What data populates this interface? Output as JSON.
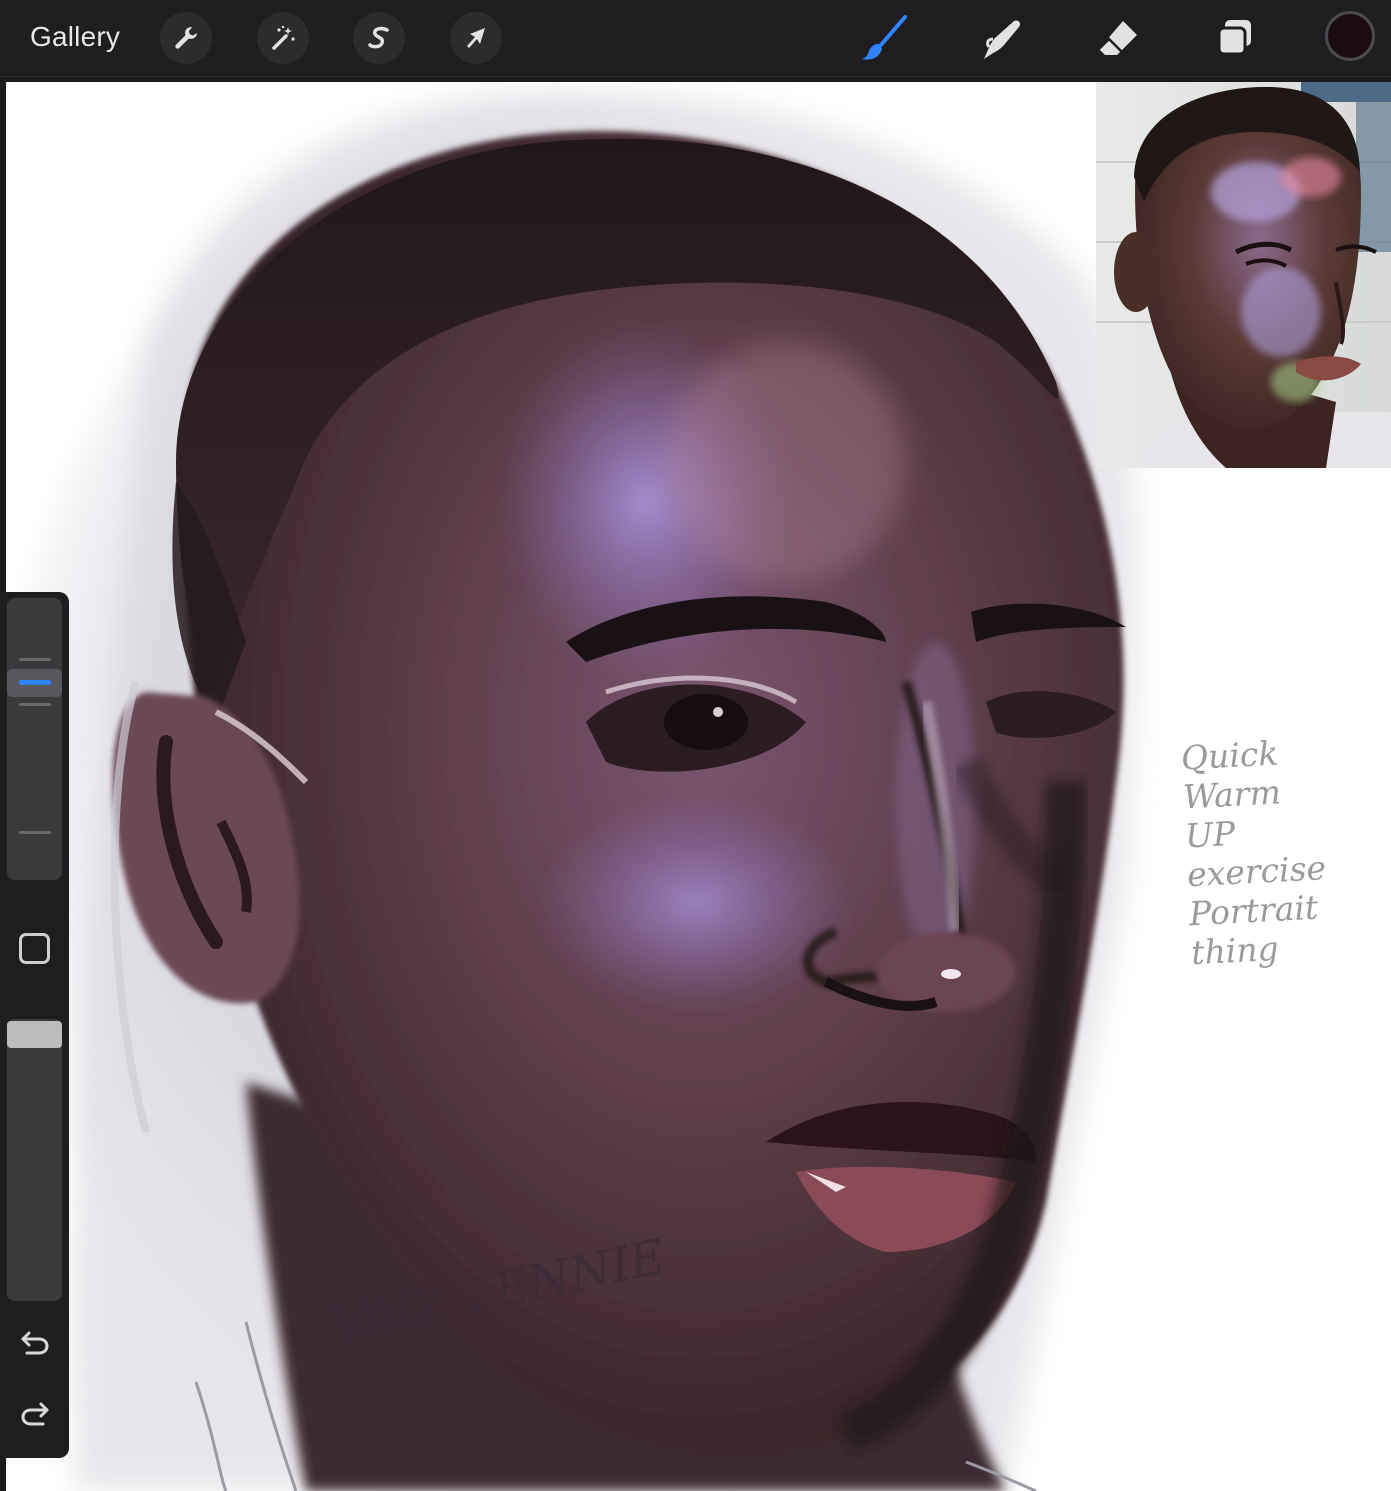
{
  "toolbar": {
    "gallery_label": "Gallery",
    "left_tools": [
      {
        "name": "actions",
        "icon": "wrench-icon"
      },
      {
        "name": "adjustments",
        "icon": "magic-wand-icon"
      },
      {
        "name": "selection",
        "icon": "selection-s-icon"
      },
      {
        "name": "transform",
        "icon": "arrow-cursor-icon"
      }
    ],
    "right_tools": [
      {
        "name": "brush",
        "icon": "brush-icon",
        "active": true,
        "color": "#2e84ff"
      },
      {
        "name": "smudge",
        "icon": "smudge-finger-icon"
      },
      {
        "name": "eraser",
        "icon": "eraser-icon"
      },
      {
        "name": "layers",
        "icon": "layers-icon"
      }
    ],
    "current_color": "#1a0c10"
  },
  "canvas": {
    "background": "#ffffff",
    "signature_text": "VAIZ LENNIE",
    "note_lines": [
      "Quick",
      "Warm",
      "UP",
      "exercise",
      "Portrait",
      "thing"
    ]
  },
  "reference": {
    "description": "reference-photo"
  },
  "sidebar": {
    "brush_size_level": 0.72,
    "opacity_level": 1.0,
    "undo_icon": "undo-icon",
    "redo_icon": "redo-icon",
    "modify_icon": "square-modify-icon"
  }
}
